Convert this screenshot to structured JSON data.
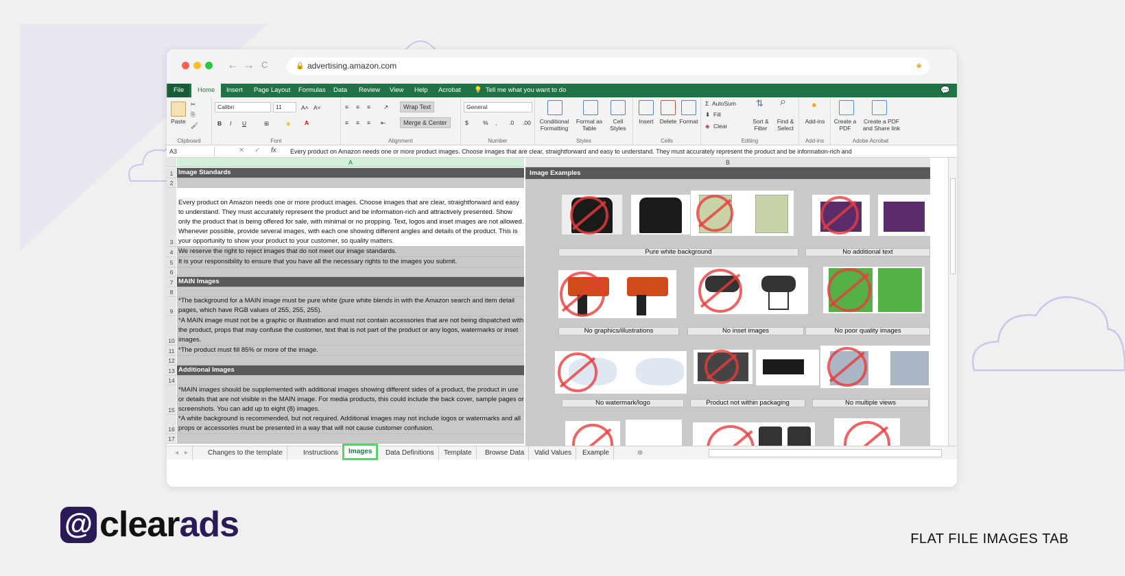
{
  "browser": {
    "url": "advertising.amazon.com",
    "back_glyph": "←",
    "forward_glyph": "→",
    "reload_glyph": "C"
  },
  "excel": {
    "ribbon_tabs": [
      "File",
      "Home",
      "Insert",
      "Page Layout",
      "Formulas",
      "Data",
      "Review",
      "View",
      "Help",
      "Acrobat"
    ],
    "tell_me": "Tell me what you want to do",
    "clipboard": {
      "paste": "Paste",
      "label": "Clipboard"
    },
    "font": {
      "name": "Calibri",
      "size": "11",
      "label": "Font"
    },
    "alignment": {
      "wrap_text": "Wrap Text",
      "merge_center": "Merge & Center",
      "label": "Alignment"
    },
    "number": {
      "format": "General",
      "label": "Number"
    },
    "styles": {
      "conditional": "Conditional Formatting",
      "format_table": "Format as Table",
      "cell_styles": "Cell Styles",
      "label": "Styles"
    },
    "cells": {
      "insert": "Insert",
      "delete": "Delete",
      "format": "Format",
      "label": "Cells"
    },
    "editing": {
      "autosum": "AutoSum",
      "fill": "Fill",
      "clear": "Clear",
      "sort": "Sort & Filter",
      "find": "Find & Select",
      "label": "Editing"
    },
    "addins": {
      "addins": "Add-ins",
      "label": "Add-ins"
    },
    "acrobat": {
      "create_pdf": "Create a PDF",
      "create_share": "Create a PDF and Share link",
      "label": "Adobe Acrobat"
    },
    "name_box": "A3",
    "formula": "Every product on Amazon needs one or more product images. Choose images that are clear, straightforward and easy to understand. They must accurately represent the product and be information-rich and",
    "columns": [
      "A",
      "B"
    ],
    "rows": [
      {
        "num": "1",
        "text": "Image Standards",
        "style": "dark"
      },
      {
        "num": "2",
        "text": "",
        "style": "grey"
      },
      {
        "num": "3",
        "text": "Every product on Amazon needs one or more product images. Choose images that are clear, straightforward and easy to understand. They must accurately represent the product and be information-rich and attractively presented. Show only the product that is being offered for sale, with minimal or no propping. Text, logos and inset images are not allowed. Whenever possible, provide several images, with each one showing different angles and details of the product. This is your opportunity to show your product to your customer, so quality matters.",
        "style": "white"
      },
      {
        "num": "4",
        "text": "We reserve the right to reject images that do not meet our image standards.",
        "style": "grey"
      },
      {
        "num": "5",
        "text": "It is your responsibility to ensure that you have all the necessary rights to the images you submit.",
        "style": "grey"
      },
      {
        "num": "6",
        "text": "",
        "style": "grey"
      },
      {
        "num": "7",
        "text": "MAIN Images",
        "style": "dark"
      },
      {
        "num": "8",
        "text": "",
        "style": "grey"
      },
      {
        "num": "9",
        "text": "*The background for a MAIN image must be pure white (pure white blends in with the Amazon search and item detail pages, which have RGB values of 255, 255, 255).",
        "style": "grey"
      },
      {
        "num": "10",
        "text": "*A MAIN image must not be a graphic or illustration and must not contain accessories that are not being dispatched with the product, props that may confuse the customer, text that is not part of the product or any logos, watermarks or inset images.",
        "style": "grey"
      },
      {
        "num": "11",
        "text": "*The product must fill 85% or more of the image.",
        "style": "grey"
      },
      {
        "num": "12",
        "text": "",
        "style": "grey"
      },
      {
        "num": "13",
        "text": "Additional Images",
        "style": "dark"
      },
      {
        "num": "14",
        "text": "",
        "style": "grey"
      },
      {
        "num": "15",
        "text": "*MAIN images should be supplemented with additional images showing different sides of a product, the product in use or details that are not visible in the MAIN image. For media products, this could include the back cover, sample pages or screenshots. You can add up to eight (8) images.",
        "style": "grey"
      },
      {
        "num": "16",
        "text": "*A white background is recommended, but not required. Additional images may not include logos or watermarks and all props or accessories must be presented in a way that will not cause customer confusion.",
        "style": "grey"
      },
      {
        "num": "17",
        "text": "",
        "style": "grey"
      }
    ],
    "image_examples_header": "Image Examples",
    "captions": [
      "Pure white background",
      "No additional text",
      "No graphics/illustrations",
      "No inset images",
      "No poor quality images",
      "No watermark/logo",
      "Product not within packaging",
      "No multiple views"
    ],
    "sheet_tabs": [
      "Changes to the template",
      "Instructions",
      "Images",
      "Data Definitions",
      "Template",
      "Browse Data",
      "Valid Values",
      "Example"
    ],
    "active_sheet": "Images"
  },
  "branding": {
    "logo_part1": "clear",
    "logo_part2": "ads",
    "caption": "FLAT FILE IMAGES TAB"
  },
  "colors": {
    "excel_green": "#217346",
    "brand_purple": "#2a1a55",
    "highlight": "#5bd06b"
  }
}
